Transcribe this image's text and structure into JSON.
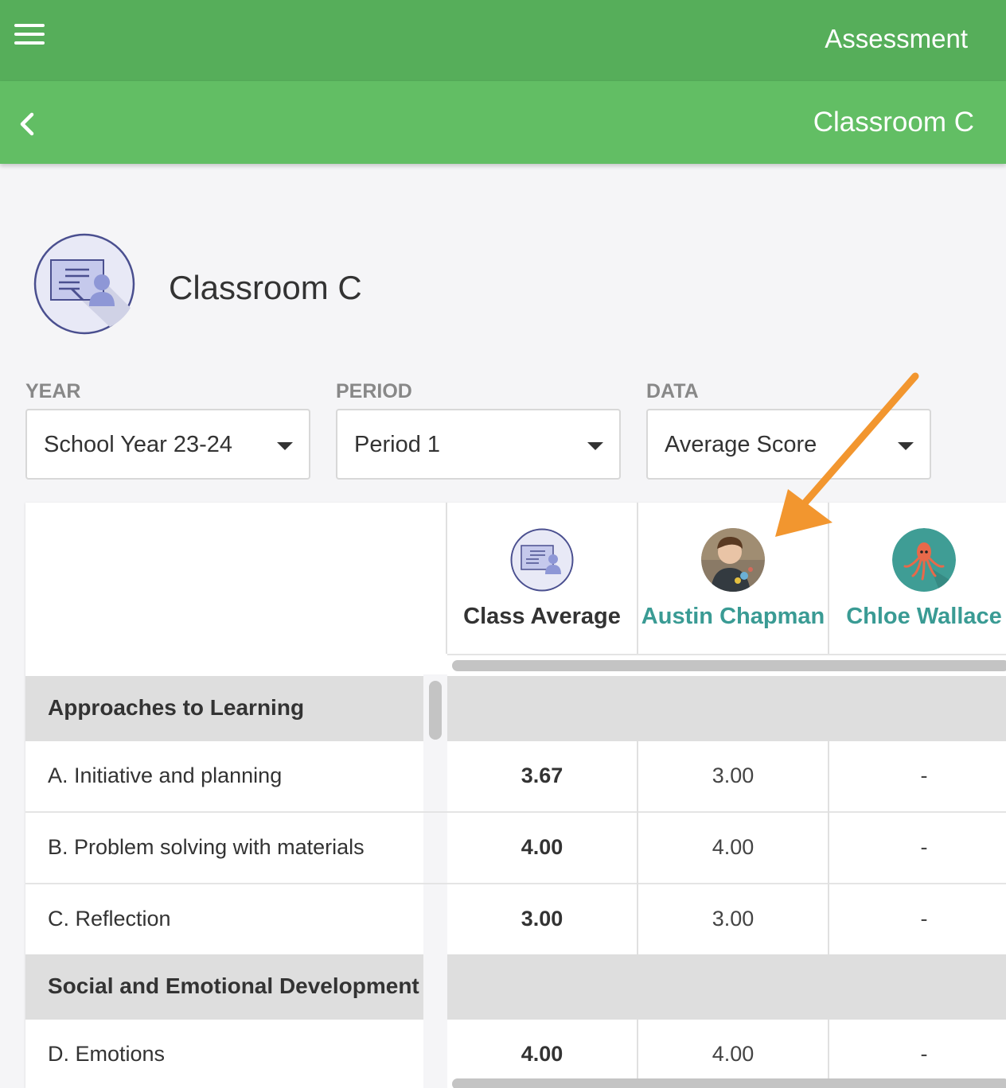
{
  "header": {
    "title": "Assessment",
    "menu_icon": "hamburger-menu-icon"
  },
  "subheader": {
    "title": "Classroom C",
    "back_icon": "chevron-left-icon"
  },
  "classroom": {
    "name": "Classroom C",
    "icon": "teacher-at-board-icon"
  },
  "filters": [
    {
      "label": "YEAR",
      "value": "School Year 23-24"
    },
    {
      "label": "PERIOD",
      "value": "Period 1"
    },
    {
      "label": "DATA",
      "value": "Average Score"
    }
  ],
  "columns": [
    {
      "name": "Class Average",
      "avatar": "teacher-at-board-icon"
    },
    {
      "name": "Austin Chapman",
      "avatar": "child-photo"
    },
    {
      "name": "Chloe Wallace",
      "avatar": "octopus-avatar"
    }
  ],
  "rows": [
    {
      "type": "group",
      "label": "Approaches to Learning"
    },
    {
      "type": "item",
      "label": "A. Initiative and planning",
      "class_average": "3.67",
      "values": [
        "3.00",
        "-"
      ]
    },
    {
      "type": "item",
      "label": "B. Problem solving with materials",
      "class_average": "4.00",
      "values": [
        "4.00",
        "-"
      ]
    },
    {
      "type": "item",
      "label": "C. Reflection",
      "class_average": "3.00",
      "values": [
        "3.00",
        "-"
      ]
    },
    {
      "type": "group",
      "label": "Social and Emotional Development"
    },
    {
      "type": "item",
      "label": "D. Emotions",
      "class_average": "4.00",
      "values": [
        "4.00",
        "-"
      ]
    }
  ],
  "colors": {
    "topbar": "#56ae5a",
    "subbar": "#62be64",
    "student_name": "#3a9b94",
    "annotation_arrow": "#f2962f"
  }
}
